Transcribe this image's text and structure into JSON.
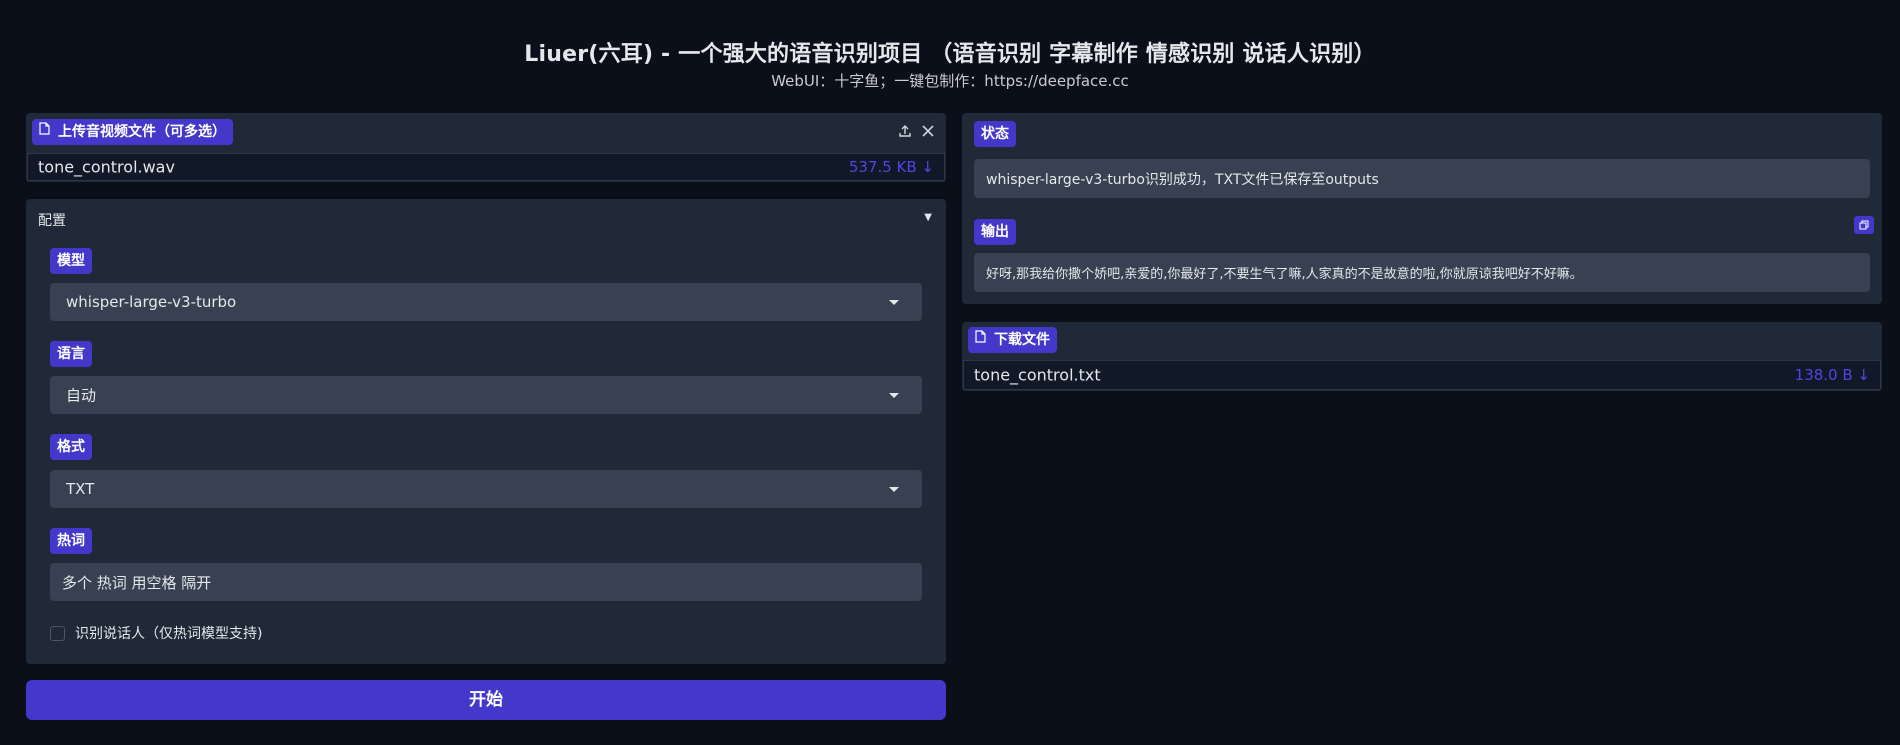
{
  "header": {
    "title": "Liuer(六耳) - 一个强大的语音识别项目 （语音识别 字幕制作 情感识别 说话人识别）",
    "subtitle": "WebUI：十字鱼；一键包制作：https://deepface.cc"
  },
  "upload": {
    "label": "上传音视频文件（可多选）",
    "file_name": "tone_control.wav",
    "file_size": "537.5 KB ↓"
  },
  "config": {
    "label": "配置",
    "toggle_glyph": "▼",
    "model": {
      "label": "模型",
      "value": "whisper-large-v3-turbo"
    },
    "language": {
      "label": "语言",
      "value": "自动"
    },
    "format": {
      "label": "格式",
      "value": "TXT"
    },
    "hotwords": {
      "label": "热词",
      "value": "多个 热词 用空格 隔开"
    },
    "speaker_checkbox": {
      "label": "识别说话人（仅热词模型支持)",
      "checked": false
    }
  },
  "start_button": {
    "label": "开始"
  },
  "status": {
    "label": "状态",
    "value": "whisper-large-v3-turbo识别成功，TXT文件已保存至outputs"
  },
  "output": {
    "label": "输出",
    "value": "好呀,那我给你撒个娇吧,亲爱的,你最好了,不要生气了嘛,人家真的不是故意的啦,你就原谅我吧好不好嘛。"
  },
  "download": {
    "label": "下载文件",
    "file_name": "tone_control.txt",
    "file_size": "138.0 B ↓"
  },
  "colors": {
    "background": "#0b0f19",
    "panel": "#1f2937",
    "accent": "#4338ca",
    "link": "#4f46e5"
  },
  "icons": [
    "file-icon",
    "upload-icon",
    "close-icon",
    "chevron-down-icon",
    "copy-icon"
  ]
}
